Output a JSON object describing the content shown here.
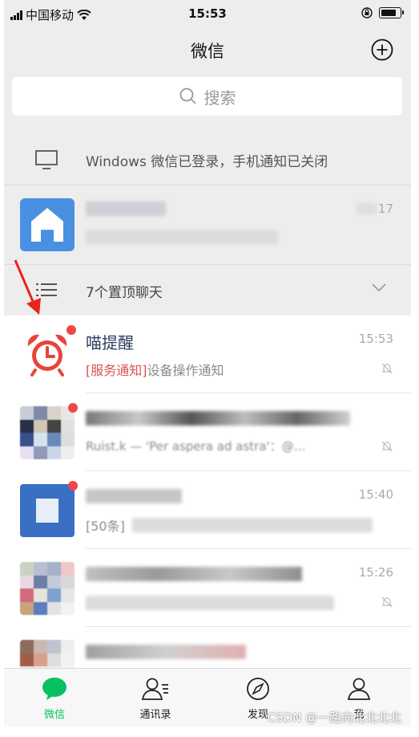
{
  "status_bar": {
    "carrier": "中国移动",
    "time": "15:53"
  },
  "header": {
    "title": "微信"
  },
  "search": {
    "placeholder": "搜索"
  },
  "windows_notice": {
    "text": "Windows 微信已登录，手机通知已关闭"
  },
  "pinned_chat": {
    "time": "17"
  },
  "pinned_group": {
    "label": "7个置顶聊天"
  },
  "chats": [
    {
      "name": "喵提醒",
      "tag": "[服务通知]",
      "preview": "设备操作通知",
      "time": "15:53",
      "muted": true,
      "icon": "alarm-clock-icon"
    },
    {
      "preview": "Ruist.k — 'Per aspera ad astra'：@…",
      "muted": true
    },
    {
      "preview": "[50条]",
      "time": "15:40"
    },
    {
      "time": "15:26",
      "muted": true
    },
    {}
  ],
  "tabs": [
    {
      "label": "微信",
      "icon": "chat-bubble-icon",
      "active": true
    },
    {
      "label": "通讯录",
      "icon": "contacts-icon"
    },
    {
      "label": "发现",
      "icon": "compass-icon"
    },
    {
      "label": "我",
      "icon": "person-icon"
    }
  ],
  "watermark": "CSDN @一路向北北北北",
  "colors": {
    "brand_green": "#07c160",
    "badge_red": "#f04646",
    "tag_red": "#d9534f",
    "arrow_red": "#e8251a"
  }
}
